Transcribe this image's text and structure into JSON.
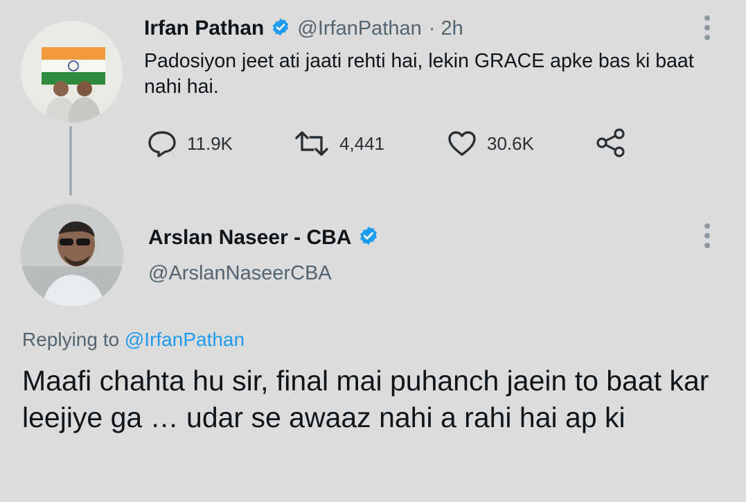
{
  "tweet1": {
    "name": "Irfan Pathan",
    "handle": "@IrfanPathan",
    "time": "· 2h",
    "text": "Padosiyon jeet ati jaati rehti hai, lekin GRACE apke bas ki baat nahi hai.",
    "replies": "11.9K",
    "retweets": "4,441",
    "likes": "30.6K"
  },
  "tweet2": {
    "name": "Arslan Naseer - CBA",
    "handle": "@ArslanNaseerCBA",
    "replying_prefix": "Replying to",
    "replying_to": "@IrfanPathan",
    "text": "Maafi chahta hu sir, final mai puhanch jaein to baat kar leejiye ga … udar se awaaz nahi a rahi hai ap ki"
  },
  "colors": {
    "verified_blue": "#1d9bf0",
    "secondary_text": "#536471",
    "background": "#dcdcdc"
  },
  "icons": [
    "reply-icon",
    "retweet-icon",
    "like-icon",
    "share-icon",
    "more-icon",
    "verified-icon"
  ]
}
